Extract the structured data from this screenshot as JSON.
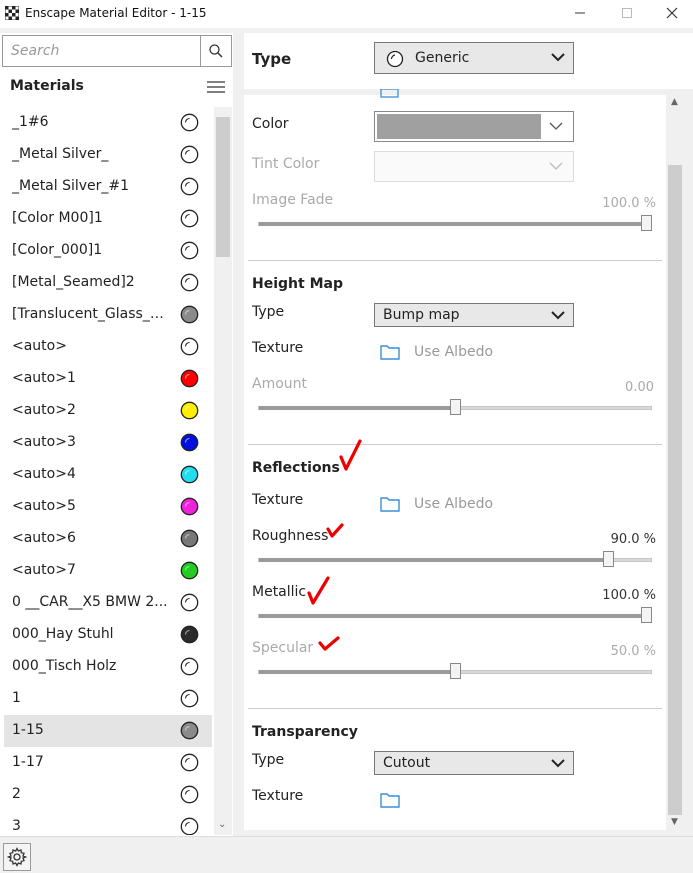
{
  "window": {
    "title": "Enscape Material Editor - 1-15"
  },
  "search": {
    "placeholder": "Search",
    "value": ""
  },
  "materials": {
    "header": "Materials",
    "items": [
      {
        "label": "_1#6",
        "ball": "white"
      },
      {
        "label": "_Metal Silver_",
        "ball": "white"
      },
      {
        "label": "_Metal Silver_#1",
        "ball": "white"
      },
      {
        "label": "[Color M00]1",
        "ball": "white"
      },
      {
        "label": "[Color_000]1",
        "ball": "white"
      },
      {
        "label": "[Metal_Seamed]2",
        "ball": "white"
      },
      {
        "label": "[Translucent_Glass_Gr...",
        "ball": "#8a8a8a"
      },
      {
        "label": "<auto>",
        "ball": "white"
      },
      {
        "label": "<auto>1",
        "ball": "#ff0000"
      },
      {
        "label": "<auto>2",
        "ball": "#ffee00"
      },
      {
        "label": "<auto>3",
        "ball": "#0011dd"
      },
      {
        "label": "<auto>4",
        "ball": "#22ddee"
      },
      {
        "label": "<auto>5",
        "ball": "#ee22dd"
      },
      {
        "label": "<auto>6",
        "ball": "#777777"
      },
      {
        "label": "<auto>7",
        "ball": "#22cc22"
      },
      {
        "label": "0 __CAR__X5 BMW 2...",
        "ball": "white"
      },
      {
        "label": "000_Hay Stuhl",
        "ball": "#2a2a2a"
      },
      {
        "label": "000_Tisch Holz",
        "ball": "white"
      },
      {
        "label": "1",
        "ball": "white"
      },
      {
        "label": "1-15",
        "ball": "#8a8a8a",
        "selected": true
      },
      {
        "label": "1-17",
        "ball": "white"
      },
      {
        "label": "2",
        "ball": "white"
      },
      {
        "label": "3",
        "ball": "white"
      }
    ]
  },
  "type": {
    "label": "Type",
    "value": "Generic"
  },
  "albedo": {
    "color_label": "Color",
    "color_swatch": "#a0a0a0",
    "tint_label": "Tint Color",
    "image_fade_label": "Image Fade",
    "image_fade_value": "100.0 %",
    "image_fade_fraction": 1.0
  },
  "height_map": {
    "header": "Height Map",
    "type_label": "Type",
    "type_value": "Bump map",
    "texture_label": "Texture",
    "texture_value": "Use Albedo",
    "amount_label": "Amount",
    "amount_value": "0.00",
    "amount_fraction": 0.5
  },
  "reflections": {
    "header": "Reflections",
    "texture_label": "Texture",
    "texture_value": "Use Albedo",
    "roughness_label": "Roughness",
    "roughness_value": "90.0 %",
    "roughness_fraction": 0.9,
    "metallic_label": "Metallic",
    "metallic_value": "100.0 %",
    "metallic_fraction": 1.0,
    "specular_label": "Specular",
    "specular_value": "50.0 %",
    "specular_fraction": 0.5
  },
  "transparency": {
    "header": "Transparency",
    "type_label": "Type",
    "type_value": "Cutout",
    "texture_label": "Texture"
  },
  "colors": {
    "check_mark": "#e00000",
    "folder": "#3a8fd8"
  }
}
